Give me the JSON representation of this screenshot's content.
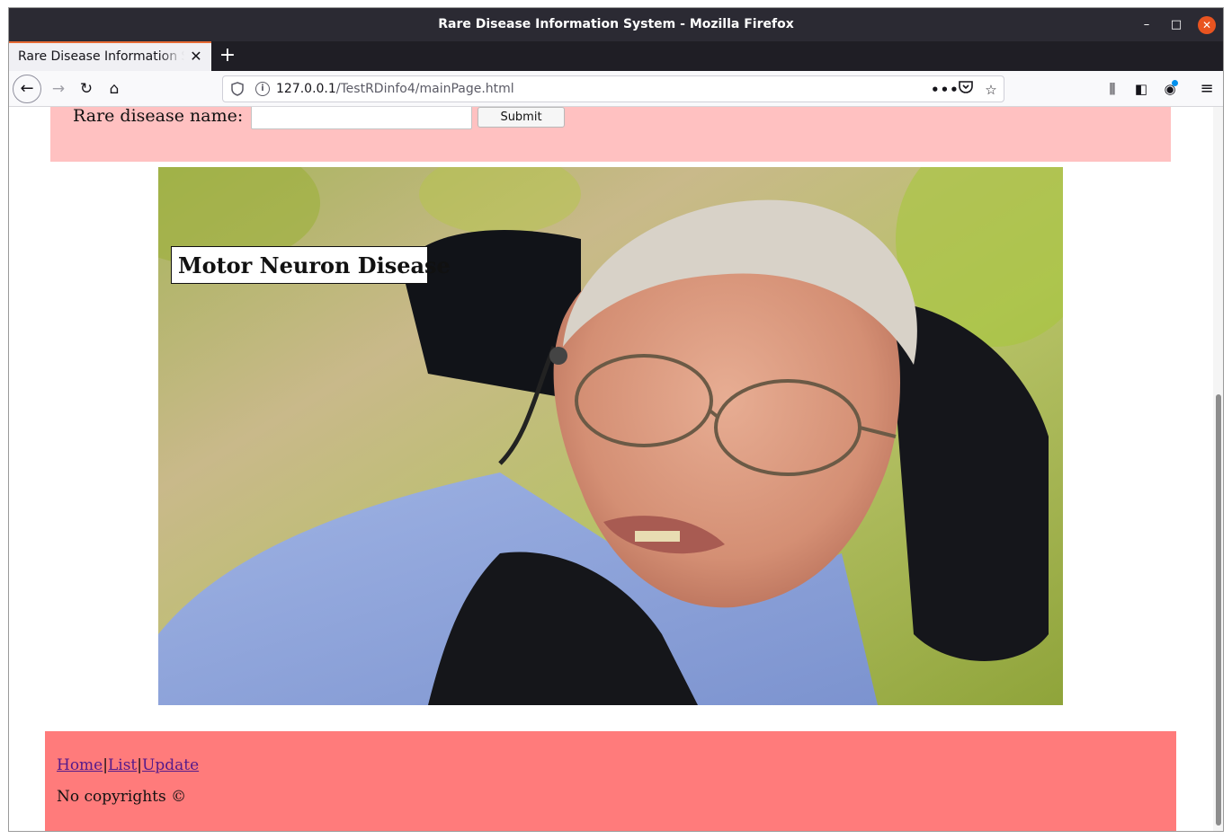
{
  "window": {
    "title": "Rare Disease Information System - Mozilla Firefox",
    "controls": {
      "minimize": "–",
      "maximize": "□",
      "close": "✕"
    }
  },
  "tabs": [
    {
      "label": "Rare Disease Information System",
      "close": "✕"
    }
  ],
  "new_tab": "+",
  "nav": {
    "back": "←",
    "forward": "→",
    "reload": "↻",
    "home": "⌂"
  },
  "urlbar": {
    "host": "127.0.0.1",
    "path": "/TestRDinfo4/mainPage.html",
    "more": "•••",
    "pocket": "◫",
    "star": "☆"
  },
  "toolbar": {
    "library": "⫼",
    "sidebar": "◧",
    "account": "◉",
    "menu": "≡"
  },
  "search": {
    "label": "Rare disease name:",
    "value": "",
    "submit_label": "Submit"
  },
  "hero": {
    "caption": "Motor Neuron Disease"
  },
  "footer": {
    "links": [
      {
        "label": "Home"
      },
      {
        "label": "List"
      },
      {
        "label": "Update"
      }
    ],
    "separator": "|",
    "copyright": "No copyrights ©"
  }
}
